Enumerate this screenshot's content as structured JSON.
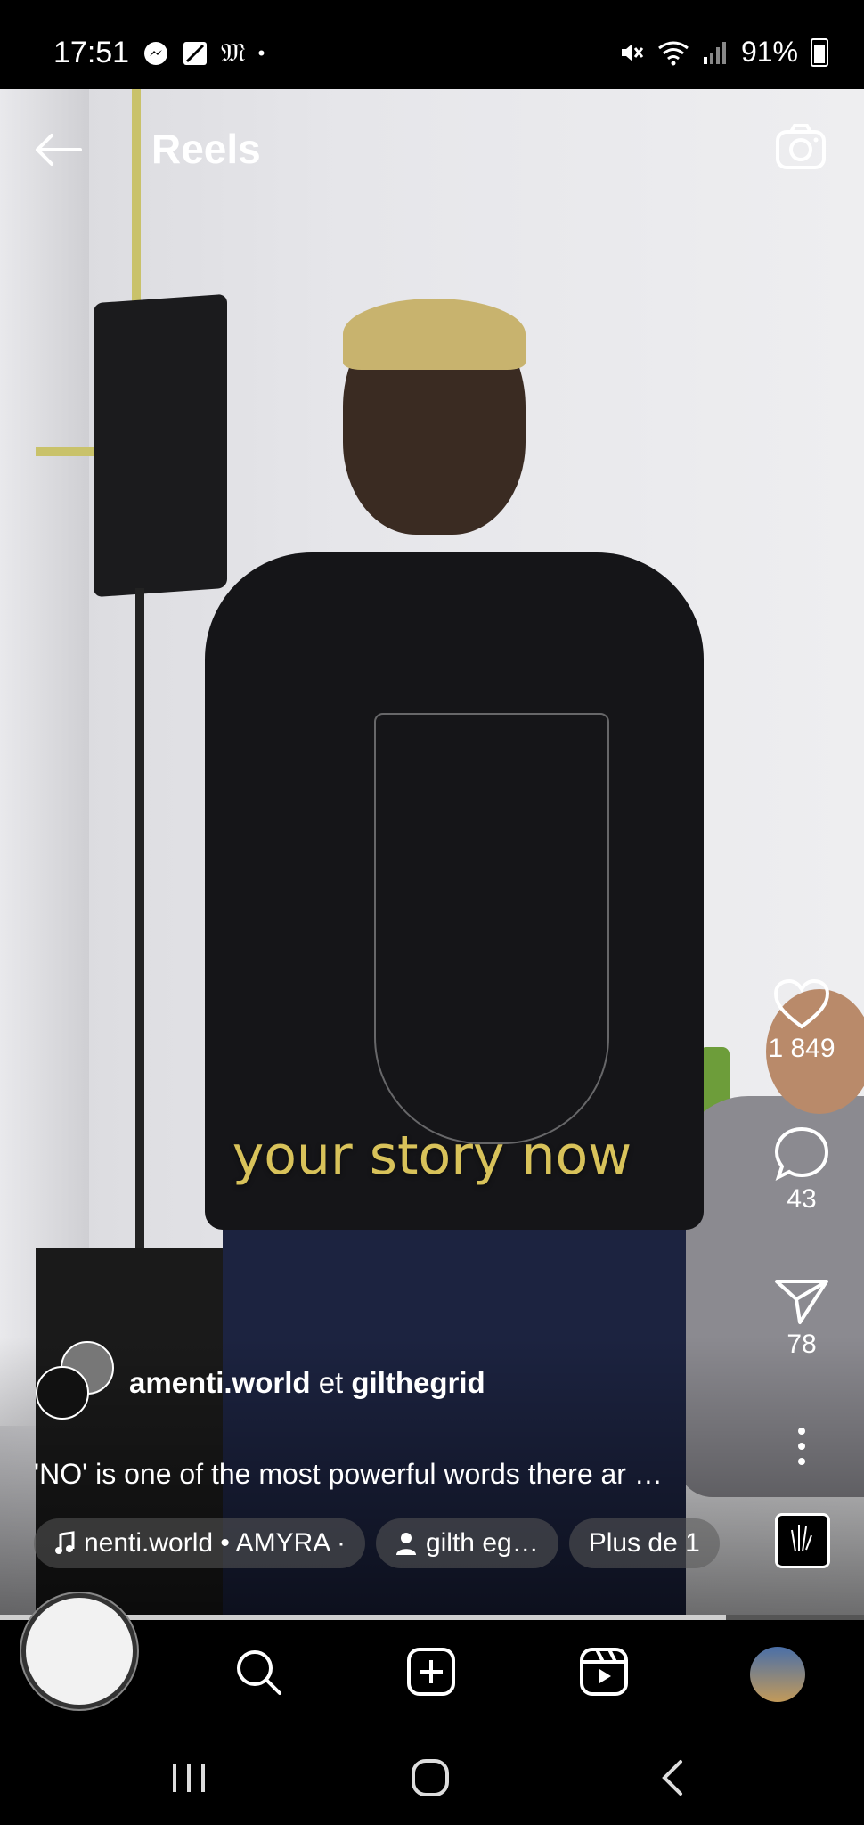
{
  "status_bar": {
    "time": "17:51",
    "left_icons": [
      "messenger-icon",
      "notes-icon",
      "gothic-m-icon",
      "dot-icon"
    ],
    "right_icons": [
      "mute-icon",
      "wifi-icon",
      "signal-icon"
    ],
    "battery": "91%"
  },
  "header": {
    "title": "Reels",
    "back_icon": "arrow-left-icon",
    "camera_icon": "camera-icon"
  },
  "video": {
    "caption_overlay": "your story now"
  },
  "actions": {
    "likes": "1 849",
    "comments": "43",
    "shares": "78"
  },
  "post": {
    "author_1": "amenti.world",
    "joiner": " et ",
    "author_2": "gilthegrid",
    "description": "'NO' is one of the most powerful words there ar …",
    "audio_chip": "nenti.world • AMYRA ·",
    "tag_chip": "gilth eg…",
    "more_chip": "Plus de 1"
  },
  "progress": {
    "value": 0.84
  },
  "nav": {
    "items": [
      "record-icon",
      "search-icon",
      "create-icon",
      "reels-icon",
      "profile-avatar"
    ]
  },
  "system_nav": [
    "recents-icon",
    "home-icon",
    "back-icon"
  ],
  "colors": {
    "caption": "#d8c25a",
    "background": "#000000"
  }
}
